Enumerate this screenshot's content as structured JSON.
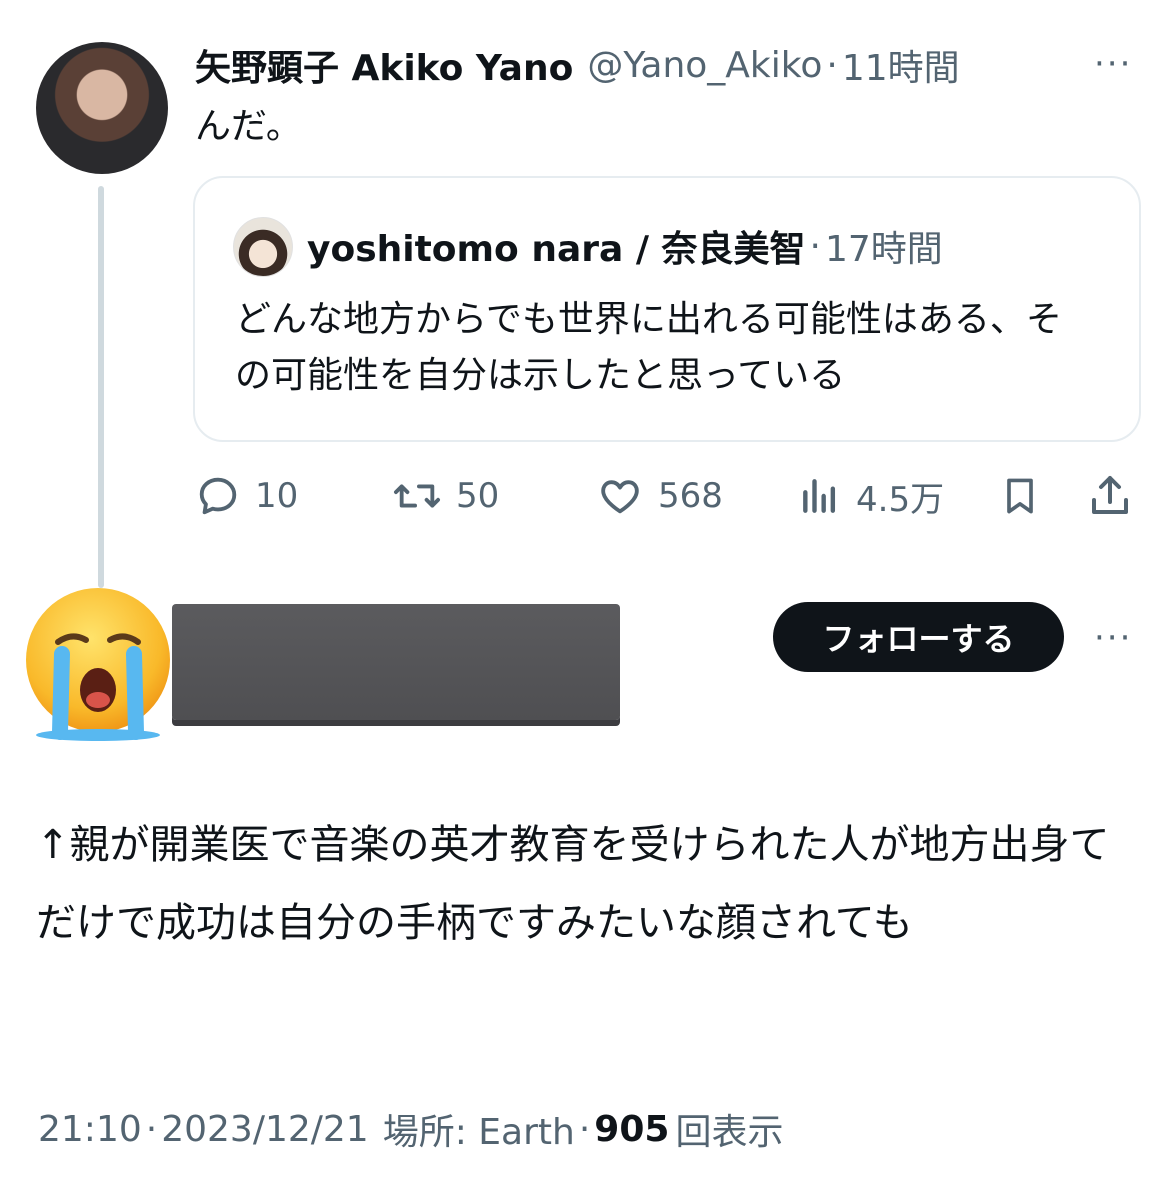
{
  "original_tweet": {
    "author_name": "矢野顕子 Akiko Yano",
    "handle": "@Yano_Akiko",
    "separator": "·",
    "time": "11時間",
    "more": "···",
    "text": "んだ。",
    "quoted": {
      "author_name": "yoshitomo nara / 奈良美智",
      "separator": "·",
      "time": "17時間",
      "text": "どんな地方からでも世界に出れる可能性はある、その可能性を自分は示したと思っている"
    },
    "actions": {
      "replies": "10",
      "retweets": "50",
      "likes": "568",
      "views": "4.5万"
    }
  },
  "reply_tweet": {
    "follow_label": "フォローする",
    "more": "···",
    "text": "↑親が開業医で音楽の英才教育を受けられた人が地方出身てだけで成功は自分の手柄ですみたいな顔されても",
    "meta": {
      "time": "21:10",
      "date": "2023/12/21",
      "location": "場所: Earth",
      "separator": "·",
      "views_count": "905",
      "views_label": "回表示"
    }
  },
  "colors": {
    "text_primary": "#0f1419",
    "text_secondary": "#536471",
    "thread_line": "#cfd9de",
    "card_border": "#e6ecf0",
    "follow_button_bg": "#0f1419"
  },
  "icons": [
    "reply-icon",
    "retweet-icon",
    "like-icon",
    "views-icon",
    "bookmark-icon",
    "share-icon",
    "crying-emoji-avatar"
  ]
}
